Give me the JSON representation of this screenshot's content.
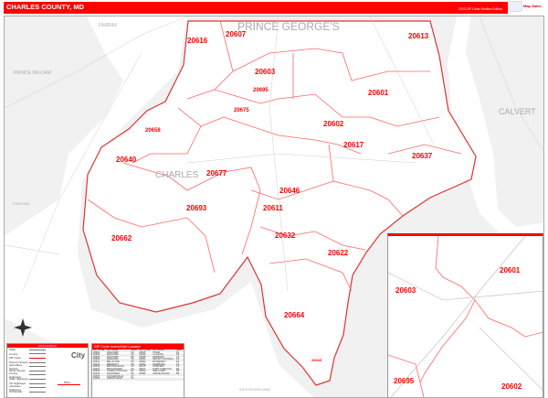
{
  "header": {
    "title": "CHARLES COUNTY, MD",
    "edition": "2023 ZIP Code Redline Edition",
    "logo_text": "Map Sales"
  },
  "colors": {
    "accent": "#ff0000",
    "land": "#f1f1f1",
    "water": "#ffffff"
  },
  "map": {
    "counties": {
      "fairfax": "FAIRFAX",
      "prince_william": "PRINCE WILLIAM",
      "prince_georges": "PRINCE GEORGE'S",
      "calvert": "CALVERT",
      "charles": "CHARLES",
      "stafford": "STAFFORD",
      "westmoreland": "WESTMORELAND"
    },
    "zips": {
      "z20616": "20616",
      "z20607": "20607",
      "z20613": "20613",
      "z20603": "20603",
      "z20695": "20695",
      "z20601": "20601",
      "z20675": "20675",
      "z20602": "20602",
      "z20658": "20658",
      "z20617": "20617",
      "z20637": "20637",
      "z20640": "20640",
      "z20677": "20677",
      "z20646": "20646",
      "z20693": "20693",
      "z20611": "20611",
      "z20632": "20632",
      "z20662": "20662",
      "z20622": "20622",
      "z20664": "20664",
      "z20645": "20645"
    }
  },
  "inset": {
    "zips": {
      "z20601": "20601",
      "z20603": "20603",
      "z20695": "20695",
      "z20602": "20602"
    }
  },
  "legend": {
    "title": "MAP LEGEND",
    "items": [
      "State",
      "County",
      "ZIP Code",
      "Primary Streets",
      "Secondary Streets",
      "Minor Streets",
      "County Highways",
      "State Highways",
      "US Highways",
      "Interstate Highways",
      "Toll Roads"
    ],
    "city_label": "City",
    "scale_label": "Miles"
  },
  "index": {
    "title": "ZIP Code Index/Grid Locator",
    "columns": [
      "ZIP CODE",
      "ZIP NAME",
      "GRID",
      "ZIP CODE",
      "ZIP NAME",
      "GRID"
    ],
    "rows": [
      [
        "20601",
        "WALDORF",
        "C6",
        "20645",
        "ISSUE",
        "F6"
      ],
      [
        "20602",
        "WALDORF",
        "C6",
        "20646",
        "LA PLATA",
        "D5"
      ],
      [
        "20603",
        "WALDORF",
        "B5",
        "20658",
        "MARBURY",
        "C3"
      ],
      [
        "20604",
        "WALDORF",
        "C6",
        "20661",
        "MOUNT VICTORIA",
        "F4"
      ],
      [
        "20611",
        "BEL ALTON",
        "D5",
        "20662",
        "NANJEMOY",
        "E2"
      ],
      [
        "20612",
        "BENEDICT",
        "D8",
        "20664",
        "NEWBURG",
        "F5"
      ],
      [
        "20616",
        "BRYANS ROAD",
        "A3",
        "20675",
        "POMFRET",
        "C4"
      ],
      [
        "20617",
        "BRYANTOWN",
        "C6",
        "20677",
        "PORT TOBACCO",
        "D4"
      ],
      [
        "20622",
        "CHARLOTTE HALL",
        "E7",
        "20693",
        "WELCOME",
        "D3"
      ],
      [
        "20632",
        "FAULKNER",
        "E5",
        "20695",
        "WHITE PLAINS",
        "B5"
      ],
      [
        "20637",
        "HUGHESVILLE",
        "C7",
        "",
        "",
        ""
      ],
      [
        "20640",
        "INDIAN HEAD",
        "C2",
        "",
        "",
        ""
      ]
    ]
  }
}
